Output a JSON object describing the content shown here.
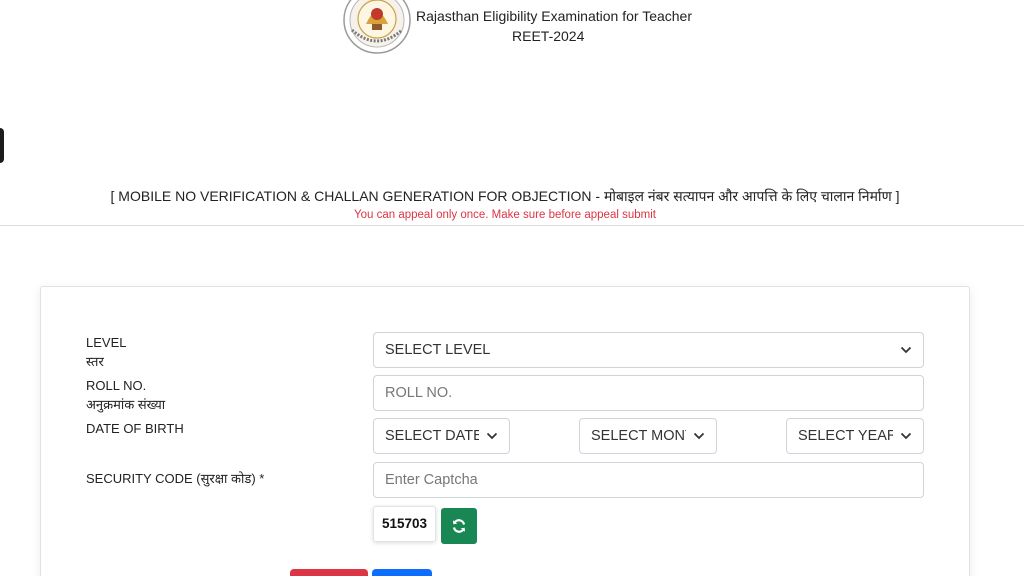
{
  "header": {
    "logo_name": "emblem-logo",
    "exam_title": "Rajasthan Eligibility Examination for Teacher",
    "exam_year": "REET-2024"
  },
  "page": {
    "heading": "[ MOBILE NO VERIFICATION & CHALLAN GENERATION FOR OBJECTION - मोबाइल नंबर सत्यापन और आपत्ति के लिए चालान निर्माण ]",
    "warning": "You can appeal only once. Make sure before appeal submit"
  },
  "form": {
    "level": {
      "label_en": "LEVEL",
      "label_hi": "स्तर",
      "selected": "SELECT LEVEL"
    },
    "roll_no": {
      "label_en": "ROLL NO.",
      "label_hi": "अनुक्रमांक संख्या",
      "placeholder": "ROLL NO.",
      "value": ""
    },
    "dob": {
      "label_en": "DATE OF BIRTH",
      "date_selected": "SELECT DATE",
      "month_selected": "SELECT MONTH",
      "year_selected": "SELECT YEAR"
    },
    "security": {
      "label": "SECURITY CODE (सुरक्षा कोड) *",
      "placeholder": "Enter Captcha",
      "value": "",
      "captcha_code": "515703",
      "refresh_icon": "refresh-icon"
    }
  },
  "colors": {
    "warning": "#dc3545",
    "refresh_button": "#198754",
    "reset_button": "#dc3545",
    "submit_button": "#0d6efd"
  }
}
